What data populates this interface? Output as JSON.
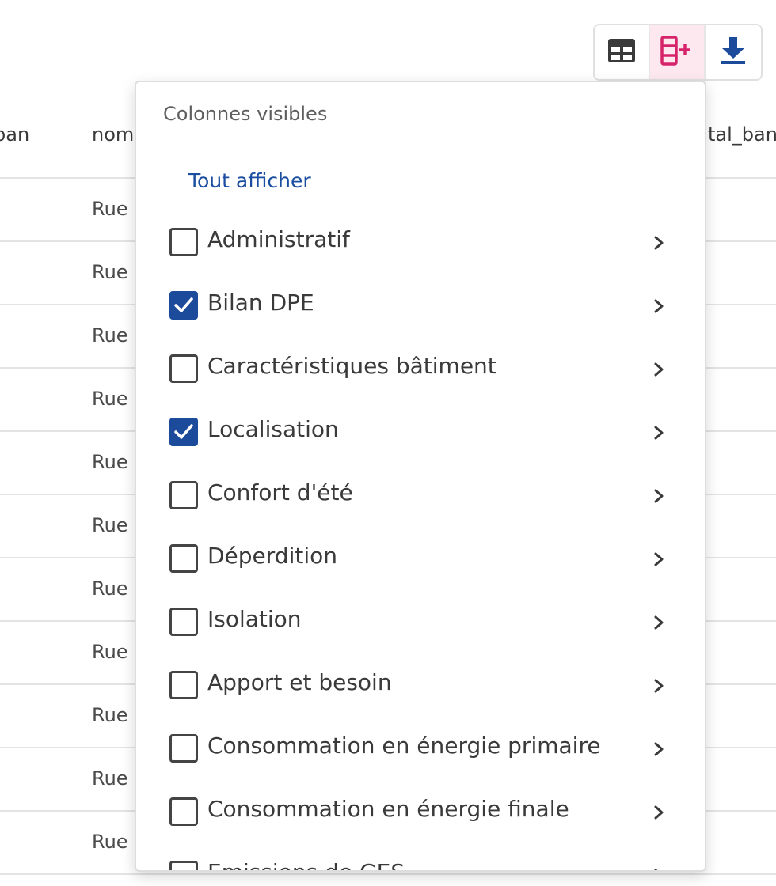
{
  "table": {
    "header_left": "ban",
    "header_mid": "nom",
    "header_right": "tal_ban",
    "cell_text": "Rue"
  },
  "toolbar": {
    "buttons": [
      {
        "icon": "table-grid-icon",
        "active": false
      },
      {
        "icon": "add-columns-icon",
        "active": true
      },
      {
        "icon": "download-icon",
        "active": false
      }
    ]
  },
  "popover": {
    "title": "Colonnes visibles",
    "show_all": "Tout afficher",
    "options": [
      {
        "label": "Administratif",
        "checked": false
      },
      {
        "label": "Bilan DPE",
        "checked": true
      },
      {
        "label": "Caractéristiques bâtiment",
        "checked": false
      },
      {
        "label": "Localisation",
        "checked": true
      },
      {
        "label": "Confort d'été",
        "checked": false
      },
      {
        "label": "Déperdition",
        "checked": false
      },
      {
        "label": "Isolation",
        "checked": false
      },
      {
        "label": "Apport et besoin",
        "checked": false
      },
      {
        "label": "Consommation en énergie primaire",
        "checked": false
      },
      {
        "label": "Consommation en énergie finale",
        "checked": false
      },
      {
        "label": "Emissions de GES",
        "checked": false
      }
    ]
  },
  "colors": {
    "accent_blue": "#1d4b9c",
    "accent_pink": "#d6246a",
    "active_bg": "#fde8ef"
  }
}
